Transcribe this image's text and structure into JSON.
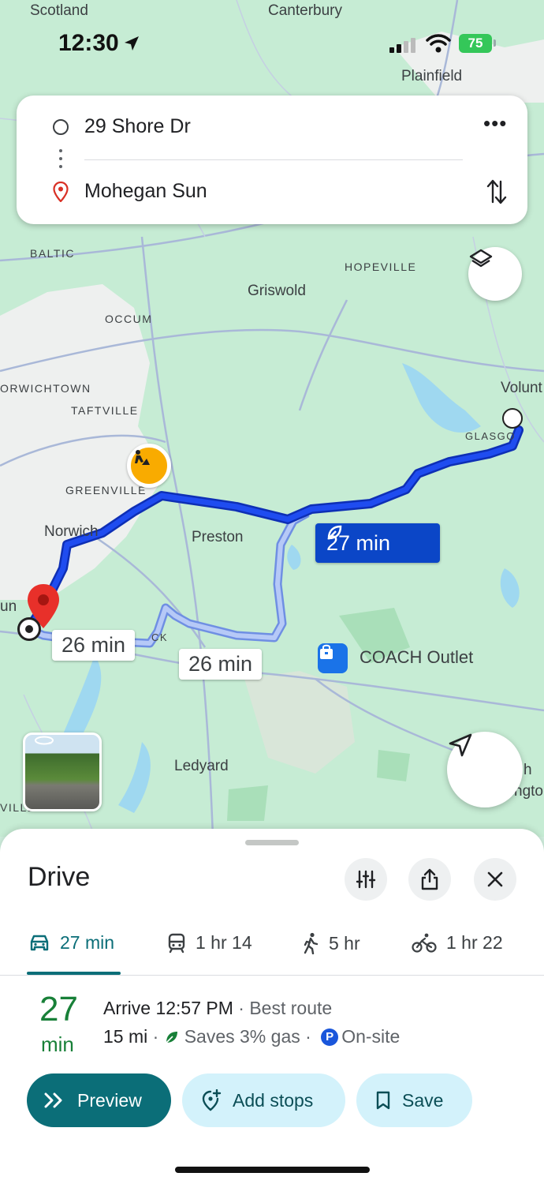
{
  "status_bar": {
    "time": "12:30",
    "battery": "75"
  },
  "directions": {
    "origin": "29 Shore Dr",
    "destination": "Mohegan Sun"
  },
  "map": {
    "places": {
      "scotland": "Scotland",
      "canterbury": "Canterbury",
      "plainfield": "Plainfield",
      "baltic": "BALTIC",
      "hopeville": "HOPEVILLE",
      "griswold": "Griswold",
      "occum": "OCCUM",
      "norwichtown": "ORWICHTOWN",
      "taftville": "TAFTVILLE",
      "voluntown": "Volunt",
      "glasgo": "GLASGO",
      "greenville": "GREENVILLE",
      "norwich": "Norwich",
      "preston": "Preston",
      "ledyard": "Ledyard",
      "un": "un",
      "ck": "CK",
      "ville": "VILLE",
      "h": "h",
      "ngton": "ngtor"
    },
    "route_times": {
      "main": "27 min",
      "alt1": "26 min",
      "alt2": "26 min"
    },
    "poi": {
      "coach": "COACH Outlet"
    }
  },
  "sheet": {
    "title": "Drive",
    "modes": [
      {
        "icon": "car-icon",
        "label": "27 min"
      },
      {
        "icon": "transit-icon",
        "label": "1 hr 14"
      },
      {
        "icon": "walk-icon",
        "label": "5 hr"
      },
      {
        "icon": "bike-icon",
        "label": "1 hr 22"
      }
    ],
    "summary": {
      "minutes": "27",
      "unit": "min",
      "arrive": "Arrive 12:57 PM",
      "best": " · Best route",
      "distance": "15 mi",
      "sep1": " · ",
      "gas": "Saves 3% gas",
      "sep2": " · ",
      "parking_badge": "P",
      "parking": "On-site"
    },
    "actions": {
      "preview": "Preview",
      "add_stops": "Add stops",
      "save": "Save"
    }
  },
  "colors": {
    "route_main": "#1a3be3",
    "route_alt": "#a7bff5",
    "accent": "#0b6e78",
    "green": "#188038"
  }
}
